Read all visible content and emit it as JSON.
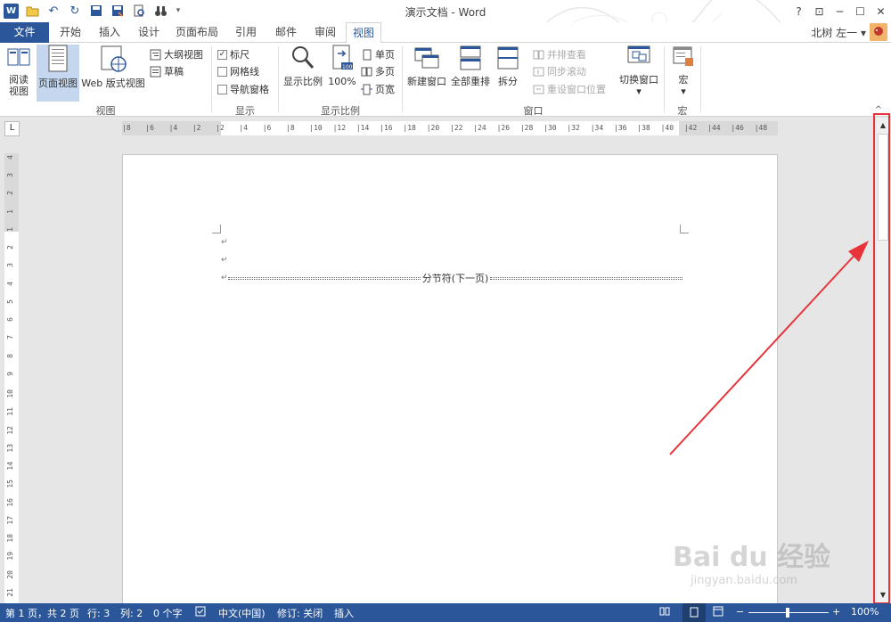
{
  "window": {
    "title": "演示文档 - Word",
    "help": "?",
    "minimize": "─",
    "restore": "☐",
    "close": "✕",
    "ribbon_display": "⊡"
  },
  "qat": {
    "undo": "↶",
    "redo": "↻",
    "more": "▾"
  },
  "tabs": [
    "文件",
    "开始",
    "插入",
    "设计",
    "页面布局",
    "引用",
    "邮件",
    "审阅",
    "视图"
  ],
  "active_tab": "视图",
  "user": {
    "name": "北树 左一",
    "dropdown": "▾"
  },
  "ribbon": {
    "views": {
      "read_mode": "阅读\n视图",
      "print_layout": "页面视图",
      "web_layout": "Web 版式视图",
      "outline": "大纲视图",
      "draft": "草稿",
      "label": "视图"
    },
    "show": {
      "ruler": "标尺",
      "ruler_checked": "✓",
      "gridlines": "网格线",
      "nav_pane": "导航窗格",
      "label": "显示"
    },
    "zoom": {
      "zoom": "显示比例",
      "hundred": "100%",
      "one_page": "单页",
      "multiple": "多页",
      "page_width": "页宽",
      "label": "显示比例"
    },
    "window": {
      "new_window": "新建窗口",
      "arrange_all": "全部重排",
      "split": "拆分",
      "side_by_side": "并排查看",
      "sync_scroll": "同步滚动",
      "reset_position": "重设窗口位置",
      "switch": "切换窗口",
      "switch_more": "▾",
      "label": "窗口"
    },
    "macros": {
      "macros": "宏",
      "macros_more": "▾",
      "label": "宏"
    },
    "collapse": "^"
  },
  "ruler": {
    "corner": "L",
    "h_ticks": [
      "8",
      "6",
      "4",
      "2",
      "2",
      "4",
      "6",
      "8",
      "10",
      "12",
      "14",
      "16",
      "18",
      "20",
      "22",
      "24",
      "26",
      "28",
      "30",
      "32",
      "34",
      "36",
      "38",
      "40",
      "42",
      "44",
      "46",
      "48"
    ],
    "v_ticks": [
      "4",
      "3",
      "2",
      "1",
      "1",
      "2",
      "3",
      "4",
      "5",
      "6",
      "7",
      "8",
      "9",
      "10",
      "11",
      "12",
      "13",
      "14",
      "15",
      "16",
      "17",
      "18",
      "19",
      "20",
      "21"
    ]
  },
  "document": {
    "para_marks": [
      "↵",
      "↵",
      "↵"
    ],
    "section_break": "分节符(下一页)"
  },
  "scrollbar": {
    "up": "▲",
    "down": "▼"
  },
  "watermark": {
    "main": "Bai du 经验",
    "sub": "jingyan.baidu.com"
  },
  "status": {
    "page": "第 1 页，共 2 页",
    "line": "行: 3",
    "column": "列: 2",
    "words": "0 个字",
    "language": "中文(中国)",
    "track_changes": "修订: 关闭",
    "mode": "插入",
    "zoom_minus": "−",
    "zoom_plus": "+",
    "zoom": "100%"
  },
  "colors": {
    "brand": "#2b579a",
    "highlight": "#e8333a",
    "selected": "#c5d7ee"
  },
  "icons": [
    "word-logo-icon",
    "open-folder-icon",
    "undo-icon",
    "redo-icon",
    "save-icon",
    "save-as-icon",
    "print-preview-icon",
    "binoculars-icon",
    "magnifier-icon",
    "page-icon",
    "window-icon"
  ]
}
